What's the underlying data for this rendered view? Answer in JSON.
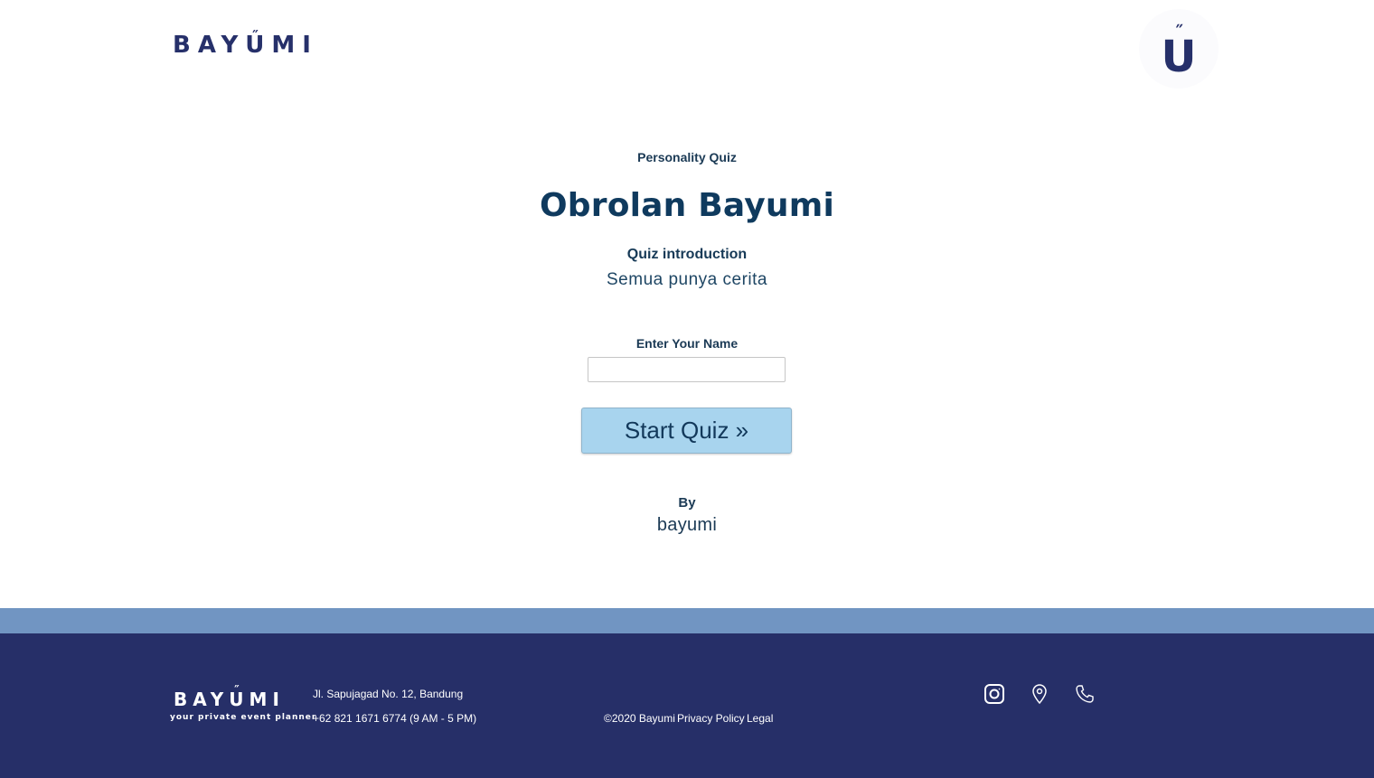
{
  "header": {
    "logo_text_before": "BAY",
    "logo_u": "U",
    "logo_u_accent": "˝",
    "logo_text_after": "MI",
    "badge_letter": "U",
    "badge_accent": "˝",
    "badge_icon": "logo-mark-icon"
  },
  "quiz": {
    "kicker": "Personality Quiz",
    "title": "Obrolan Bayumi",
    "intro_label": "Quiz introduction",
    "intro_text": "Semua punya cerita",
    "name_label": "Enter Your Name",
    "name_value": "",
    "start_label": "Start Quiz »",
    "by_label": "By",
    "by_name": "bayumi"
  },
  "footer": {
    "logo_text_before": "BAY",
    "logo_u": "U",
    "logo_u_accent": "˝",
    "logo_text_after": "MI",
    "tagline": "your private event planner",
    "address": "Jl. Sapujagad No. 12, Bandung",
    "phone": "+62 821 1671 6774 (9 AM - 5 PM)",
    "copyright": "©2020 Bayumi",
    "privacy": "Privacy Policy",
    "legal": "Legal",
    "icons": [
      "instagram-icon",
      "location-pin-icon",
      "phone-icon"
    ]
  },
  "colors": {
    "brand_navy": "#262f68",
    "strip_blue": "#7195c2",
    "button_blue": "#a8d4ee",
    "text_dark_blue": "#0f3a5e"
  }
}
